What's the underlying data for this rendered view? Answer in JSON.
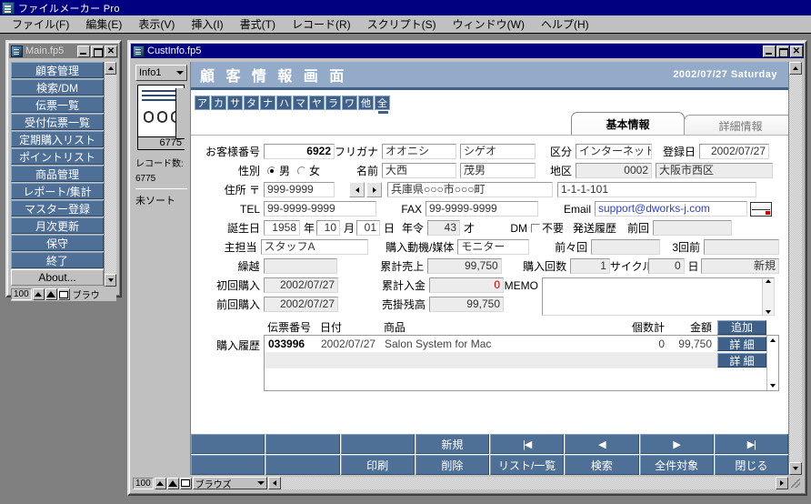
{
  "app": {
    "title": "ファイルメーカー Pro",
    "icon": "filemaker-icon",
    "menus": [
      {
        "label": "ファイル(F)"
      },
      {
        "label": "編集(E)"
      },
      {
        "label": "表示(V)"
      },
      {
        "label": "挿入(I)"
      },
      {
        "label": "書式(T)"
      },
      {
        "label": "レコード(R)"
      },
      {
        "label": "スクリプト(S)"
      },
      {
        "label": "ウィンドウ(W)"
      },
      {
        "label": "ヘルプ(H)"
      }
    ]
  },
  "main_window": {
    "title": "Main.fp5",
    "buttons": [
      {
        "label": "顧客管理"
      },
      {
        "label": "検索/DM"
      },
      {
        "label": "伝票一覧"
      },
      {
        "label": "受付伝票一覧"
      },
      {
        "label": "定期購入リスト"
      },
      {
        "label": "ポイントリスト"
      },
      {
        "label": "商品管理"
      },
      {
        "label": "レポート/集計"
      },
      {
        "label": "マスター登録"
      },
      {
        "label": "月次更新"
      },
      {
        "label": "保守"
      },
      {
        "label": "終了"
      },
      {
        "label": "About..."
      }
    ],
    "status": {
      "zoom": "100",
      "mode": "ブラウ"
    }
  },
  "cust_window": {
    "title": "CustInfo.fp5",
    "status_pane": {
      "layout": "Info1",
      "record_number": "6775",
      "record_count_label": "レコード数:",
      "record_count": "6775",
      "sort_status": "未ソート"
    },
    "banner": {
      "title": "顧 客 情 報 画 面",
      "date": "2002/07/27 Saturday"
    },
    "kana_tabs": [
      "ア",
      "カ",
      "サ",
      "タ",
      "ナ",
      "ハ",
      "マ",
      "ヤ",
      "ラ",
      "ワ",
      "他",
      "全"
    ],
    "kana_active": "全",
    "tabs": [
      {
        "label": "基本情報",
        "active": true
      },
      {
        "label": "詳細情報",
        "active": false
      },
      {
        "label": "",
        "active": false
      }
    ],
    "form": {
      "customer_no_label": "お客様番号",
      "customer_no": "6922",
      "furigana_label": "フリガナ",
      "furigana_sei": "オオニシ",
      "furigana_mei": "シゲオ",
      "kubun_label": "区分",
      "kubun": "インターネット",
      "touroku_label": "登録日",
      "touroku_date": "2002/07/27",
      "gender_label": "性別",
      "gender_male": "男",
      "gender_female": "女",
      "gender_selected": "男",
      "name_label": "名前",
      "name_sei": "大西",
      "name_mei": "茂男",
      "chiku_label": "地区",
      "chiku_code": "0002",
      "chiku_name": "大阪市西区",
      "address_label": "住所 〒",
      "zip": "999-9999",
      "address1": "兵庫県○○○市○○○町",
      "address2": "1-1-1-101",
      "tel_label": "TEL",
      "tel": "99-9999-9999",
      "fax_label": "FAX",
      "fax": "99-9999-9999",
      "email_label": "Email",
      "email": "support@dworks-j.com",
      "birth_label": "誕生日",
      "birth_year": "1958",
      "birth_year_unit": "年",
      "birth_month": "10",
      "birth_month_unit": "月",
      "birth_day": "01",
      "birth_day_unit": "日",
      "age_label": "年令",
      "age": "43",
      "age_unit": "才",
      "dm_label": "DM",
      "dm_unneeded": "不要",
      "dm_history_label": "発送履歴",
      "dm_prev_label": "前回",
      "dm_prev": "",
      "staff_label": "主担当",
      "staff": "スタッフA",
      "motive_label": "購入動機/媒体",
      "motive": "モニター",
      "dm_prev2_label": "前々回",
      "dm_prev2": "",
      "dm_prev3_label": "3回前",
      "dm_prev3": "",
      "carryover_label": "繰越",
      "carryover": "",
      "total_sales_label": "累計売上",
      "total_sales": "99,750",
      "purchase_count_label": "購入回数",
      "purchase_count": "1",
      "cycle_label": "サイクル",
      "cycle": "0",
      "cycle_unit": "日",
      "status_new": "新規",
      "first_purchase_label": "初回購入",
      "first_purchase": "2002/07/27",
      "total_payment_label": "累計入金",
      "total_payment": "0",
      "memo_label": "MEMO",
      "memo": "",
      "last_purchase_label": "前回購入",
      "last_purchase": "2002/07/27",
      "receivable_label": "売掛残高",
      "receivable": "99,750"
    },
    "history": {
      "row_label": "購入履歴",
      "columns": [
        "伝票番号",
        "日付",
        "商品",
        "個数計",
        "金額"
      ],
      "add_button": "追加",
      "detail_button": "詳 細",
      "rows": [
        {
          "slip_no": "033996",
          "date": "2002/07/27",
          "product": "Salon System for Mac",
          "qty": "0",
          "amount": "99,750"
        },
        {
          "slip_no": "",
          "date": "",
          "product": "",
          "qty": "",
          "amount": ""
        }
      ]
    },
    "bottom_buttons": {
      "row1": [
        "",
        "",
        "",
        "新規",
        "|◀",
        "◀",
        "▶",
        "▶|"
      ],
      "row2": [
        "",
        "",
        "印刷",
        "削除",
        "リスト/一覧",
        "検索",
        "全件対象",
        "閉じる"
      ]
    },
    "status": {
      "zoom": "100",
      "mode": "ブラウズ"
    }
  },
  "colors": {
    "titlebar_active": "#000080",
    "titlebar_inactive": "#808080",
    "banner": "#93abc9",
    "accent_dark": "#3f6189",
    "button_blue": "#4e6f96",
    "desktop": "#808080",
    "chrome": "#c0c0c0",
    "link": "#2b3fd0"
  }
}
